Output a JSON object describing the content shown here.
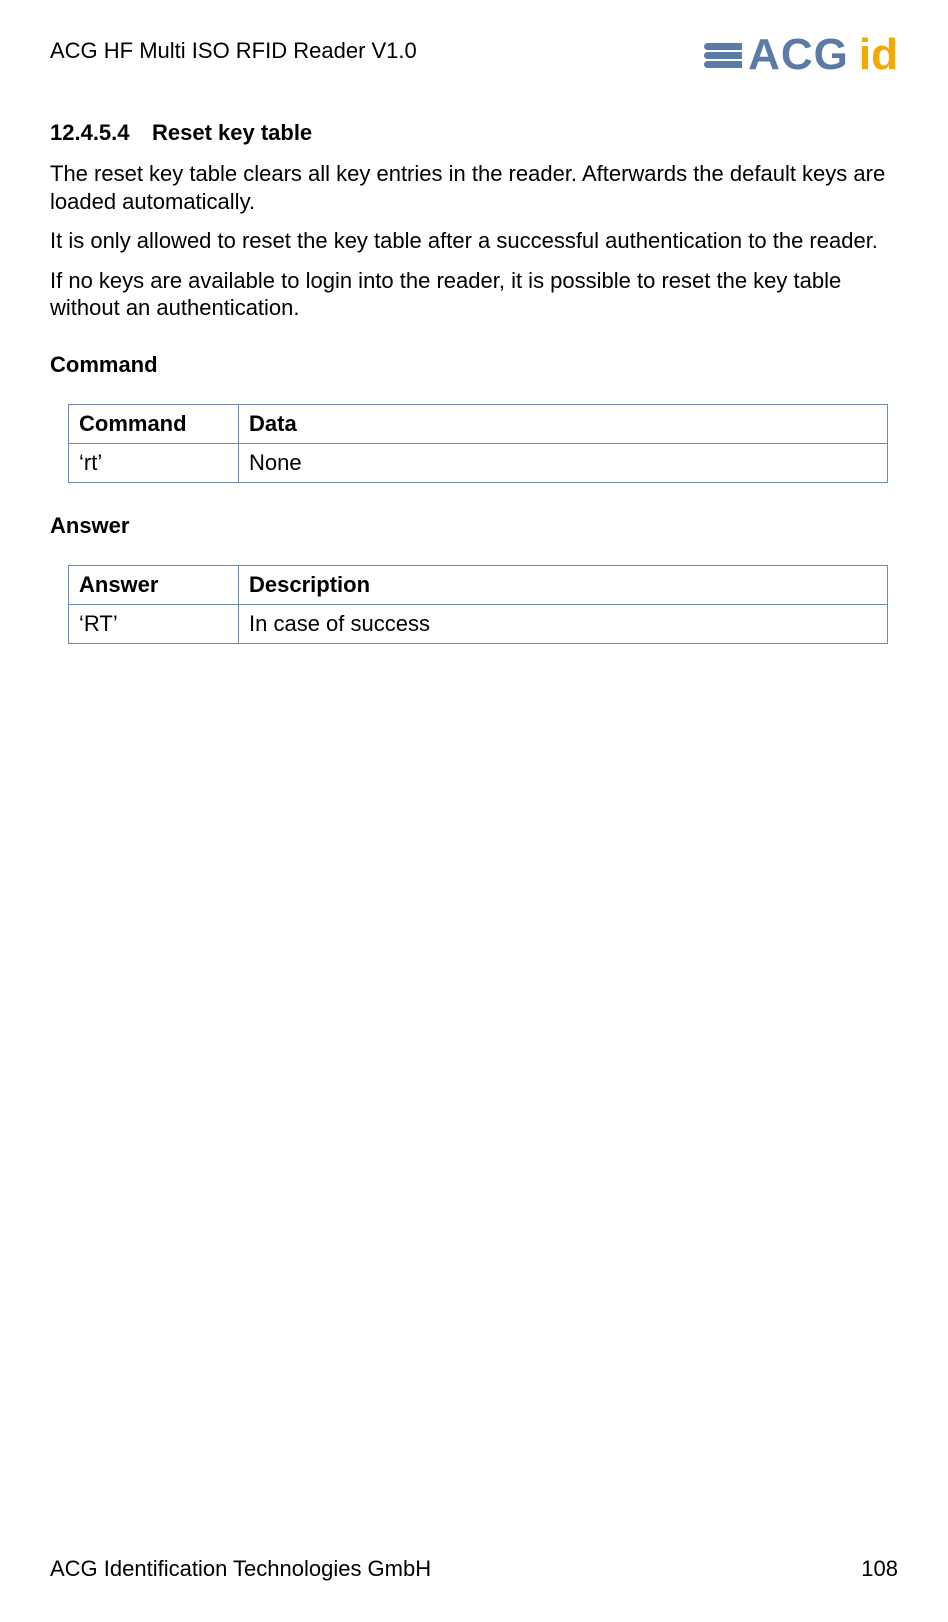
{
  "header": {
    "doc_title": "ACG HF Multi ISO RFID Reader V1.0",
    "logo_acg": "ACG",
    "logo_id": "id"
  },
  "section": {
    "number": "12.4.5.4",
    "title": "Reset key table"
  },
  "paragraphs": {
    "p1": "The reset key table clears all key entries in the reader. Afterwards the default keys are loaded automatically.",
    "p2": "It is only allowed to reset the key table after a successful authentication to the reader.",
    "p3": "If no keys are available to login into the reader, it is possible to reset the key table without an authentication."
  },
  "command_section": {
    "heading": "Command",
    "th1": "Command",
    "th2": "Data",
    "td1": "‘rt’",
    "td2": "None"
  },
  "answer_section": {
    "heading": "Answer",
    "th1": "Answer",
    "th2": "Description",
    "td1": "‘RT’",
    "td2": "In case of success"
  },
  "footer": {
    "company": "ACG Identification Technologies GmbH",
    "page": "108"
  }
}
